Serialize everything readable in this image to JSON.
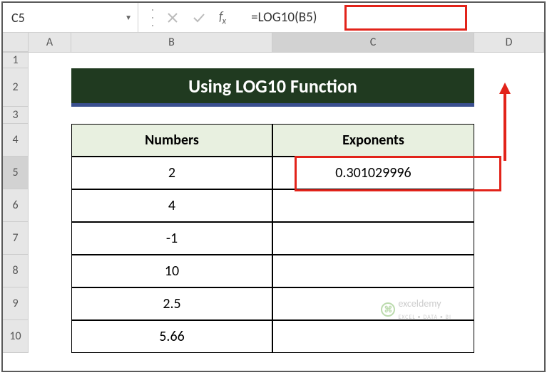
{
  "nameBox": "C5",
  "formula": "=LOG10(B5)",
  "colHeaders": {
    "a": "A",
    "b": "B",
    "c": "C",
    "d": "D"
  },
  "rowHeaders": [
    "1",
    "2",
    "3",
    "4",
    "5",
    "6",
    "7",
    "8",
    "9",
    "10"
  ],
  "title": "Using LOG10 Function",
  "table": {
    "headers": {
      "numbers": "Numbers",
      "exponents": "Exponents"
    },
    "rows": [
      {
        "num": "2",
        "exp": "0.301029996"
      },
      {
        "num": "4",
        "exp": ""
      },
      {
        "num": "-1",
        "exp": ""
      },
      {
        "num": "10",
        "exp": ""
      },
      {
        "num": "2.5",
        "exp": ""
      },
      {
        "num": "5.66",
        "exp": ""
      }
    ]
  },
  "watermark": {
    "name": "exceldemy",
    "tag": "EXCEL • DATA • BI"
  },
  "chart_data": null
}
